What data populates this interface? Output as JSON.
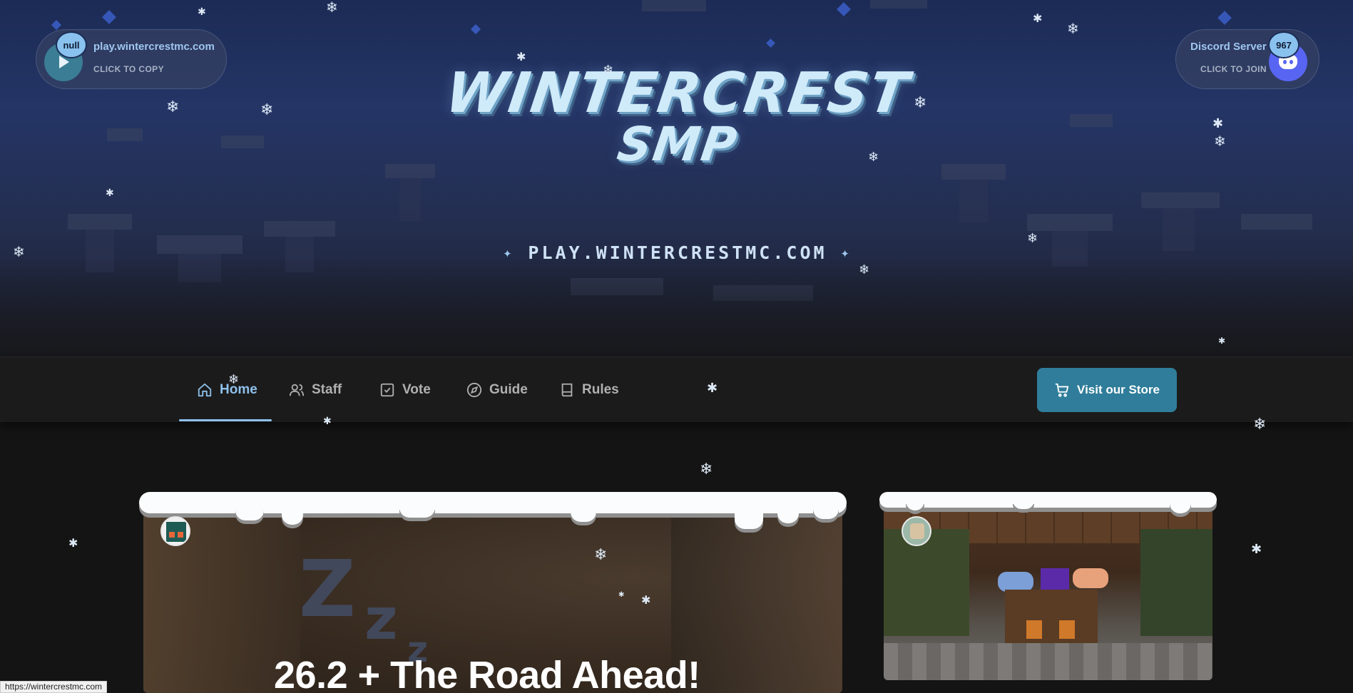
{
  "server_pill": {
    "title": "play.wintercrestmc.com",
    "subtitle": "CLICK TO COPY",
    "badge": "null",
    "icon": "play-icon"
  },
  "discord_pill": {
    "title": "Discord Server",
    "subtitle": "CLICK TO JOIN",
    "badge": "967",
    "icon": "discord-icon"
  },
  "logo": {
    "line1": "WINTERCREST",
    "line2": "SMP"
  },
  "server_ip": "PLAY.WINTERCRESTMC.COM",
  "nav": {
    "items": [
      {
        "label": "Home",
        "icon": "home-icon",
        "active": true
      },
      {
        "label": "Staff",
        "icon": "users-icon",
        "active": false
      },
      {
        "label": "Vote",
        "icon": "checkbox-icon",
        "active": false
      },
      {
        "label": "Guide",
        "icon": "compass-icon",
        "active": false
      },
      {
        "label": "Rules",
        "icon": "book-icon",
        "active": false
      }
    ],
    "store_label": "Visit our Store",
    "store_icon": "cart-icon"
  },
  "posts": [
    {
      "title": "26.2 + The Road Ahead!"
    }
  ],
  "status_url": "https://wintercrestmc.com",
  "colors": {
    "accent": "#8ec1ec",
    "store_button": "#2f7d9a",
    "discord": "#5865f2",
    "background": "#141414"
  }
}
